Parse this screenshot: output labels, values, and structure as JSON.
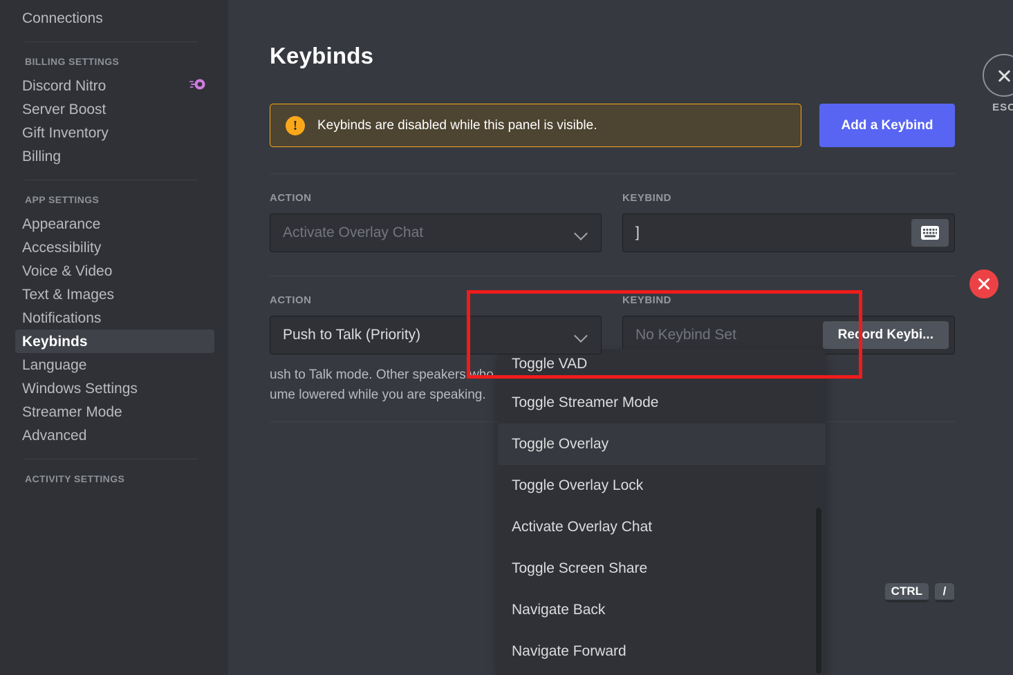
{
  "sidebar": {
    "top_items": [
      {
        "label": "Connections",
        "icon": null,
        "selected": false
      }
    ],
    "sections": [
      {
        "heading": "BILLING SETTINGS",
        "items": [
          {
            "label": "Discord Nitro",
            "icon": "nitro-boost-icon",
            "selected": false
          },
          {
            "label": "Server Boost",
            "icon": null,
            "selected": false
          },
          {
            "label": "Gift Inventory",
            "icon": null,
            "selected": false
          },
          {
            "label": "Billing",
            "icon": null,
            "selected": false
          }
        ]
      },
      {
        "heading": "APP SETTINGS",
        "items": [
          {
            "label": "Appearance",
            "icon": null,
            "selected": false
          },
          {
            "label": "Accessibility",
            "icon": null,
            "selected": false
          },
          {
            "label": "Voice & Video",
            "icon": null,
            "selected": false
          },
          {
            "label": "Text & Images",
            "icon": null,
            "selected": false
          },
          {
            "label": "Notifications",
            "icon": null,
            "selected": false
          },
          {
            "label": "Keybinds",
            "icon": null,
            "selected": true
          },
          {
            "label": "Language",
            "icon": null,
            "selected": false
          },
          {
            "label": "Windows Settings",
            "icon": null,
            "selected": false
          },
          {
            "label": "Streamer Mode",
            "icon": null,
            "selected": false
          },
          {
            "label": "Advanced",
            "icon": null,
            "selected": false
          }
        ]
      },
      {
        "heading": "ACTIVITY SETTINGS",
        "items": []
      }
    ]
  },
  "main": {
    "page_title": "Keybinds",
    "warning": {
      "icon": "warning-exclamation-icon",
      "text": "Keybinds are disabled while this panel is visible.",
      "border_color": "#faa81a",
      "background_color": "#4d4431"
    },
    "add_keybind_button": {
      "label": "Add a Keybind",
      "color": "#5865f2"
    },
    "column_headers": {
      "action": "ACTION",
      "keybind": "KEYBIND"
    },
    "rows": [
      {
        "action_value": "Activate Overlay Chat",
        "keybind_value": "]",
        "keybind_placeholder": "",
        "keybind_icon": "keyboard-icon",
        "has_record_button": false,
        "description": ""
      },
      {
        "action_value": "Push to Talk (Priority)",
        "keybind_value": "",
        "keybind_placeholder": "No Keybind Set",
        "record_button_label": "Record Keybi...",
        "has_record_button": true,
        "description_line_1": "ush to Talk mode. Other speakers who are not also",
        "description_line_2": "ume lowered while you are speaking."
      }
    ],
    "delete_button": {
      "icon": "close-x-icon",
      "color": "#ed4245"
    },
    "escape_button": {
      "icon": "close-x-icon",
      "label": "ESC"
    },
    "keycaps": [
      {
        "label": "CTRL"
      },
      {
        "label": "/"
      }
    ]
  },
  "dropdown": {
    "open": true,
    "options": [
      {
        "label": "Toggle VAD",
        "state": "clipped"
      },
      {
        "label": "Toggle Streamer Mode",
        "state": "normal"
      },
      {
        "label": "Toggle Overlay",
        "state": "active"
      },
      {
        "label": "Toggle Overlay Lock",
        "state": "normal"
      },
      {
        "label": "Activate Overlay Chat",
        "state": "normal"
      },
      {
        "label": "Toggle Screen Share",
        "state": "normal"
      },
      {
        "label": "Navigate Back",
        "state": "normal"
      },
      {
        "label": "Navigate Forward",
        "state": "normal"
      }
    ]
  },
  "annotation": {
    "type": "red-highlight-rectangle",
    "color": "#f01c1c"
  }
}
